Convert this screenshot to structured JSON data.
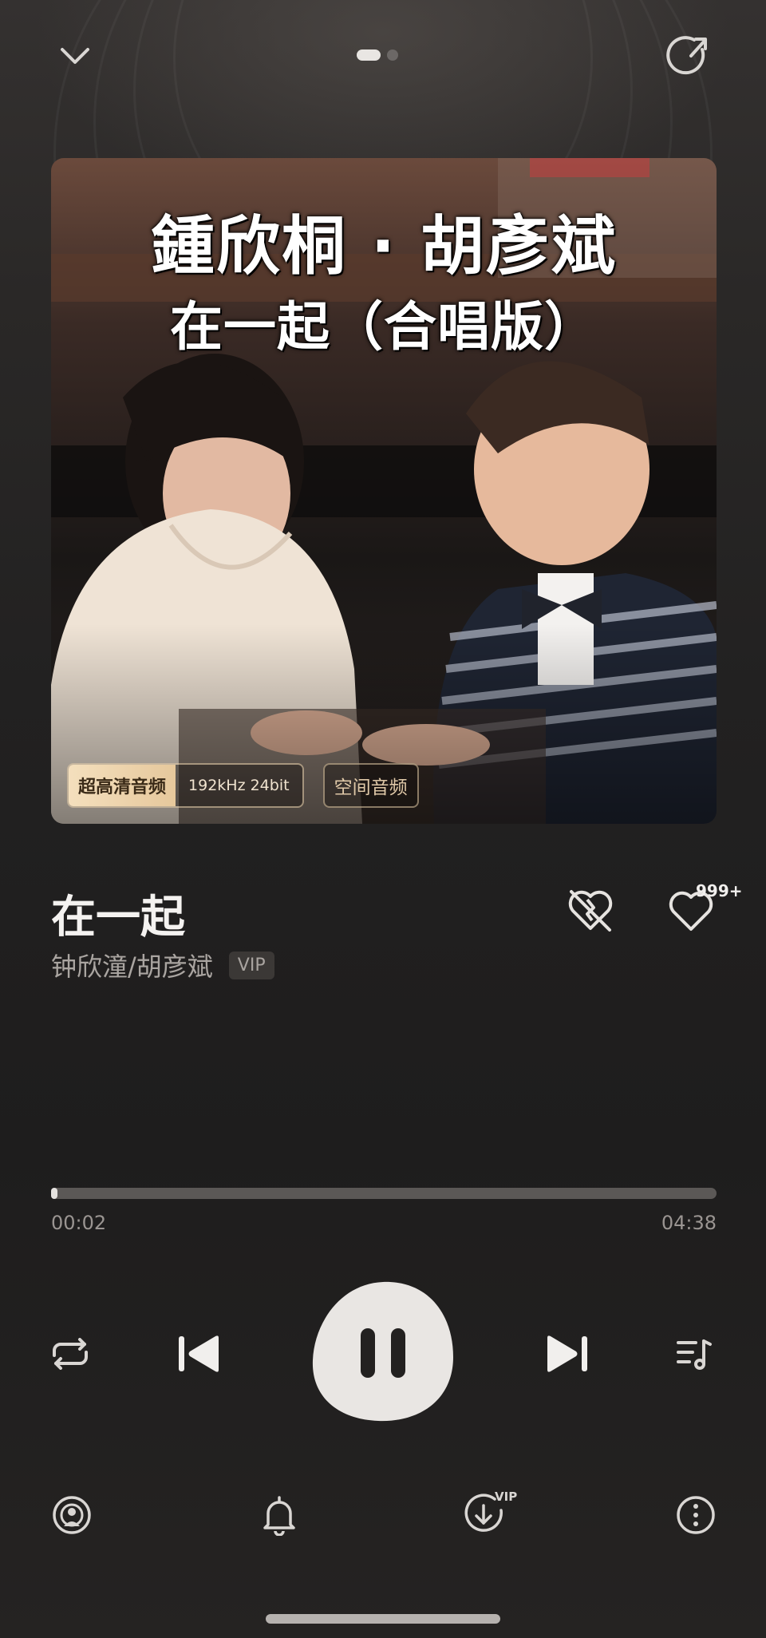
{
  "header": {
    "collapse_icon": "chevron-down-icon",
    "share_icon": "share-arrow-icon",
    "page_count": 2,
    "active_page": 1
  },
  "album": {
    "cover_line1": "鍾欣桐 · 胡彥斌",
    "cover_line2": "在一起（合唱版）",
    "quality_label": "超高清音频",
    "quality_spec": "192kHz  24bit",
    "spatial_label": "空间音频"
  },
  "song": {
    "title": "在一起",
    "artist": "钟欣潼/胡彦斌",
    "vip_label": "VIP",
    "dislike_icon": "broken-heart-icon",
    "like_icon": "heart-icon",
    "like_count": "999+"
  },
  "progress": {
    "current": "00:02",
    "total": "04:38",
    "fraction": 0.007
  },
  "controls": {
    "repeat_icon": "repeat-icon",
    "previous_icon": "previous-track-icon",
    "play_state_icon": "pause-icon",
    "next_icon": "next-track-icon",
    "playlist_icon": "playlist-icon"
  },
  "bottom_bar": {
    "items": [
      "listen-together-icon",
      "bell-icon",
      "download-icon",
      "more-icon"
    ],
    "download_badge": "VIP"
  },
  "colors": {
    "background": "#1f1e1e",
    "accent_gold": "#f4dfbd",
    "text_primary": "#f4f2f0",
    "text_secondary": "#aaa5a1"
  }
}
